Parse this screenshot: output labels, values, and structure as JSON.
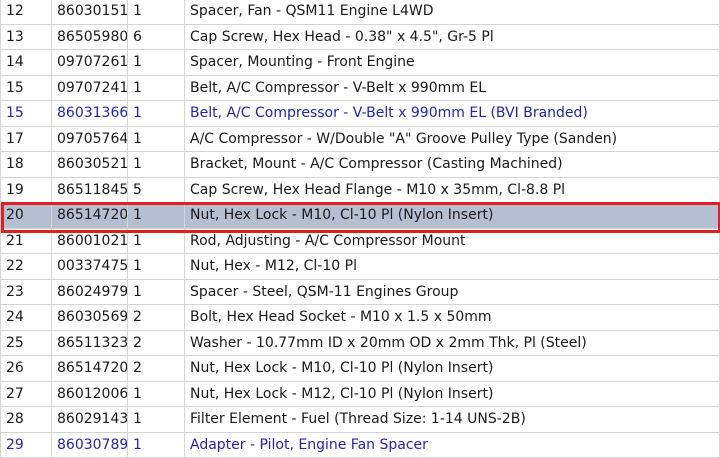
{
  "parts_table": {
    "selected_row_number": "20",
    "rows": [
      {
        "num": "12",
        "part": "86030151",
        "qty": "1",
        "desc": "Spacer, Fan - QSM11 Engine L4WD",
        "linked": false
      },
      {
        "num": "13",
        "part": "86505980",
        "qty": "6",
        "desc": "Cap Screw, Hex Head - 0.38\" x 4.5\", Gr-5 Pl",
        "linked": false
      },
      {
        "num": "14",
        "part": "09707261",
        "qty": "1",
        "desc": "Spacer, Mounting - Front Engine",
        "linked": false
      },
      {
        "num": "15",
        "part": "09707241",
        "qty": "1",
        "desc": "Belt, A/C Compressor - V-Belt x 990mm EL",
        "linked": false
      },
      {
        "num": "15",
        "part": "86031366",
        "qty": "1",
        "desc": "Belt, A/C Compressor - V-Belt x 990mm EL (BVI Branded)",
        "linked": true
      },
      {
        "num": "17",
        "part": "09705764",
        "qty": "1",
        "desc": "A/C Compressor - W/Double \"A\" Groove Pulley Type (Sanden)",
        "linked": false
      },
      {
        "num": "18",
        "part": "86030521",
        "qty": "1",
        "desc": "Bracket, Mount - A/C Compressor (Casting Machined)",
        "linked": false
      },
      {
        "num": "19",
        "part": "86511845",
        "qty": "5",
        "desc": "Cap Screw, Hex Head Flange - M10 x 35mm, Cl-8.8 Pl",
        "linked": false
      },
      {
        "num": "20",
        "part": "86514720",
        "qty": "1",
        "desc": "Nut, Hex Lock - M10, Cl-10 Pl (Nylon Insert)",
        "linked": false
      },
      {
        "num": "21",
        "part": "86001021",
        "qty": "1",
        "desc": "Rod, Adjusting - A/C Compressor Mount",
        "linked": false
      },
      {
        "num": "22",
        "part": "00337475",
        "qty": "1",
        "desc": "Nut, Hex - M12, Cl-10 Pl",
        "linked": false
      },
      {
        "num": "23",
        "part": "86024979",
        "qty": "1",
        "desc": "Spacer - Steel, QSM-11 Engines Group",
        "linked": false
      },
      {
        "num": "24",
        "part": "86030569",
        "qty": "2",
        "desc": "Bolt, Hex Head Socket - M10 x 1.5 x 50mm",
        "linked": false
      },
      {
        "num": "25",
        "part": "86511323",
        "qty": "2",
        "desc": "Washer - 10.77mm ID x 20mm OD x 2mm Thk, Pl (Steel)",
        "linked": false
      },
      {
        "num": "26",
        "part": "86514720",
        "qty": "2",
        "desc": "Nut, Hex Lock - M10, Cl-10 Pl (Nylon Insert)",
        "linked": false
      },
      {
        "num": "27",
        "part": "86012006",
        "qty": "1",
        "desc": "Nut, Hex Lock - M12, Cl-10 Pl (Nylon Insert)",
        "linked": false
      },
      {
        "num": "28",
        "part": "86029143",
        "qty": "1",
        "desc": "Filter Element - Fuel (Thread Size: 1-14 UNS-2B)",
        "linked": false
      },
      {
        "num": "29",
        "part": "86030789",
        "qty": "1",
        "desc": "Adapter - Pilot, Engine Fan Spacer",
        "linked": true
      }
    ]
  },
  "colors": {
    "link_text": "#2424b0",
    "selected_row_bg": "#b6bfd2",
    "selected_outline": "#e02020",
    "grid_line": "#d4d4d4"
  }
}
